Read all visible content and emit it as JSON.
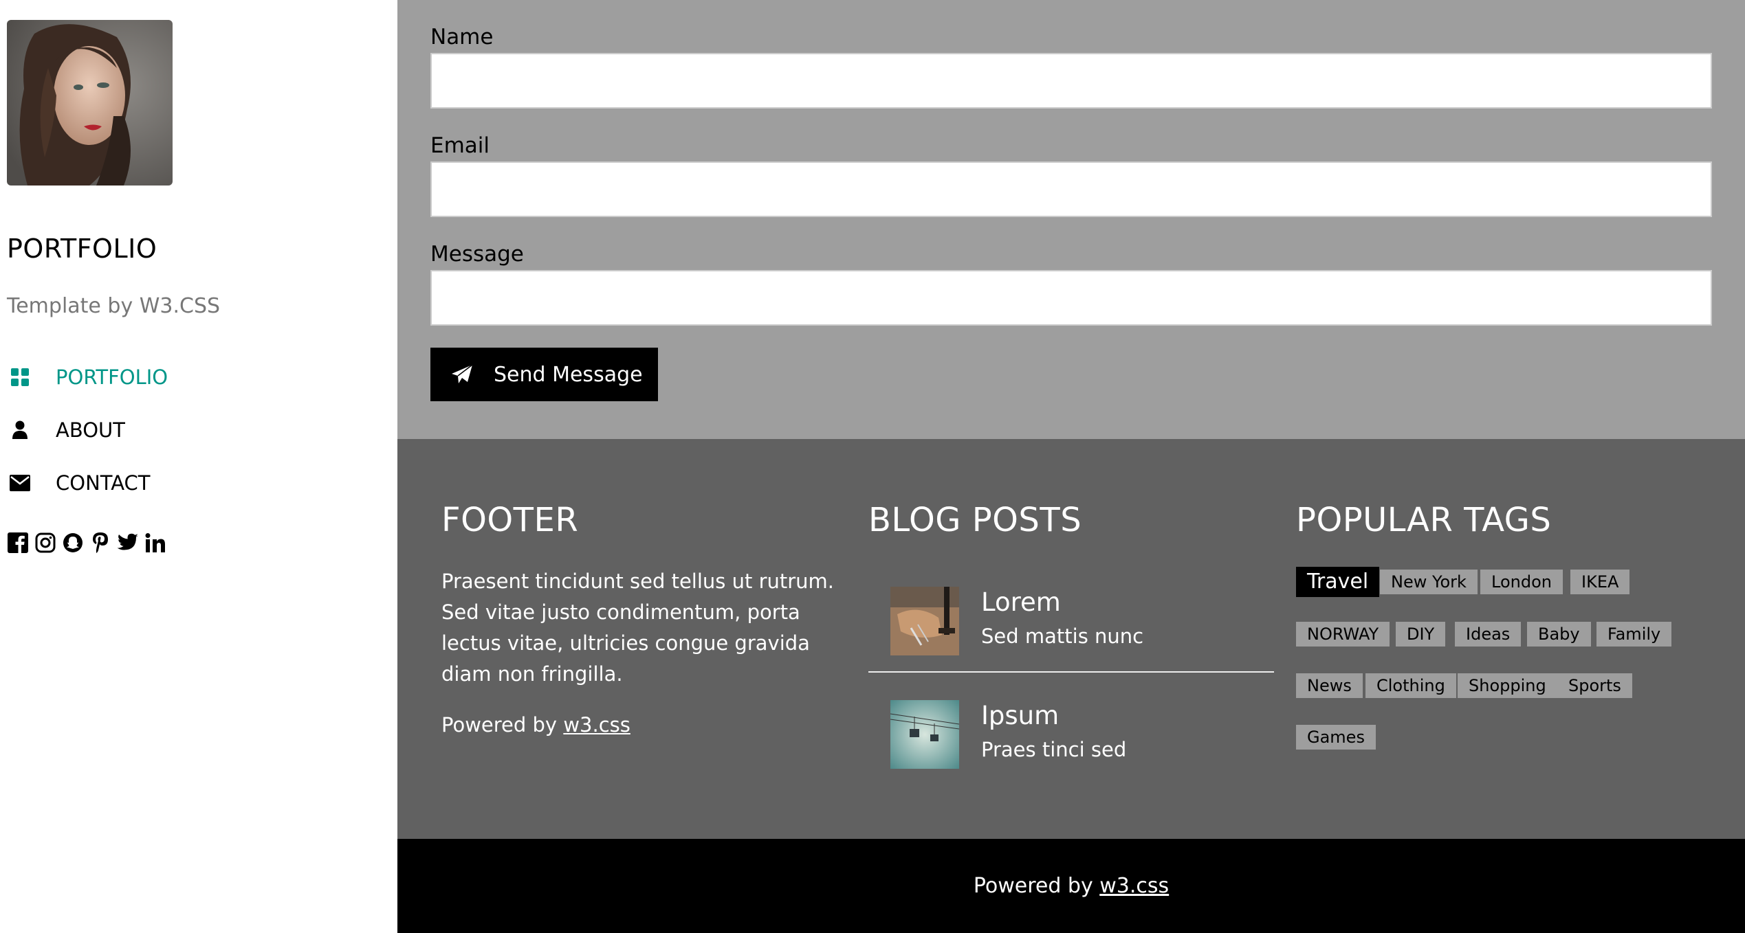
{
  "sidebar": {
    "brand": "PORTFOLIO",
    "tagline": "Template by W3.CSS",
    "nav": [
      {
        "label": "PORTFOLIO",
        "icon": "grid-icon",
        "active": true
      },
      {
        "label": "ABOUT",
        "icon": "user-icon",
        "active": false
      },
      {
        "label": "CONTACT",
        "icon": "envelope-icon",
        "active": false
      }
    ],
    "social": [
      "facebook-icon",
      "instagram-icon",
      "snapchat-icon",
      "pinterest-icon",
      "twitter-icon",
      "linkedin-icon"
    ]
  },
  "form": {
    "name_label": "Name",
    "name_value": "",
    "email_label": "Email",
    "email_value": "",
    "message_label": "Message",
    "message_value": "",
    "send_label": "Send Message"
  },
  "footer": {
    "title": "FOOTER",
    "text": "Praesent tincidunt sed tellus ut rutrum. Sed vitae justo condimentum, porta lectus vitae, ultricies congue gravida diam non fringilla.",
    "powered_prefix": "Powered by ",
    "powered_link": "w3.css"
  },
  "blog": {
    "title": "BLOG POSTS",
    "posts": [
      {
        "title": "Lorem",
        "subtitle": "Sed mattis nunc"
      },
      {
        "title": "Ipsum",
        "subtitle": "Praes tinci sed"
      }
    ]
  },
  "tags": {
    "title": "POPULAR TAGS",
    "items": [
      "Travel",
      "New York",
      "London",
      "IKEA",
      "NORWAY",
      "DIY",
      "Ideas",
      "Baby",
      "Family",
      "News",
      "Clothing",
      "Shopping",
      "Sports",
      "Games"
    ]
  },
  "bottom": {
    "powered_prefix": "Powered by ",
    "powered_link": "w3.css"
  },
  "colors": {
    "accent": "#009688",
    "form_bg": "#9e9e9e",
    "footer_bg": "#616161",
    "bottom_bg": "#000000"
  }
}
